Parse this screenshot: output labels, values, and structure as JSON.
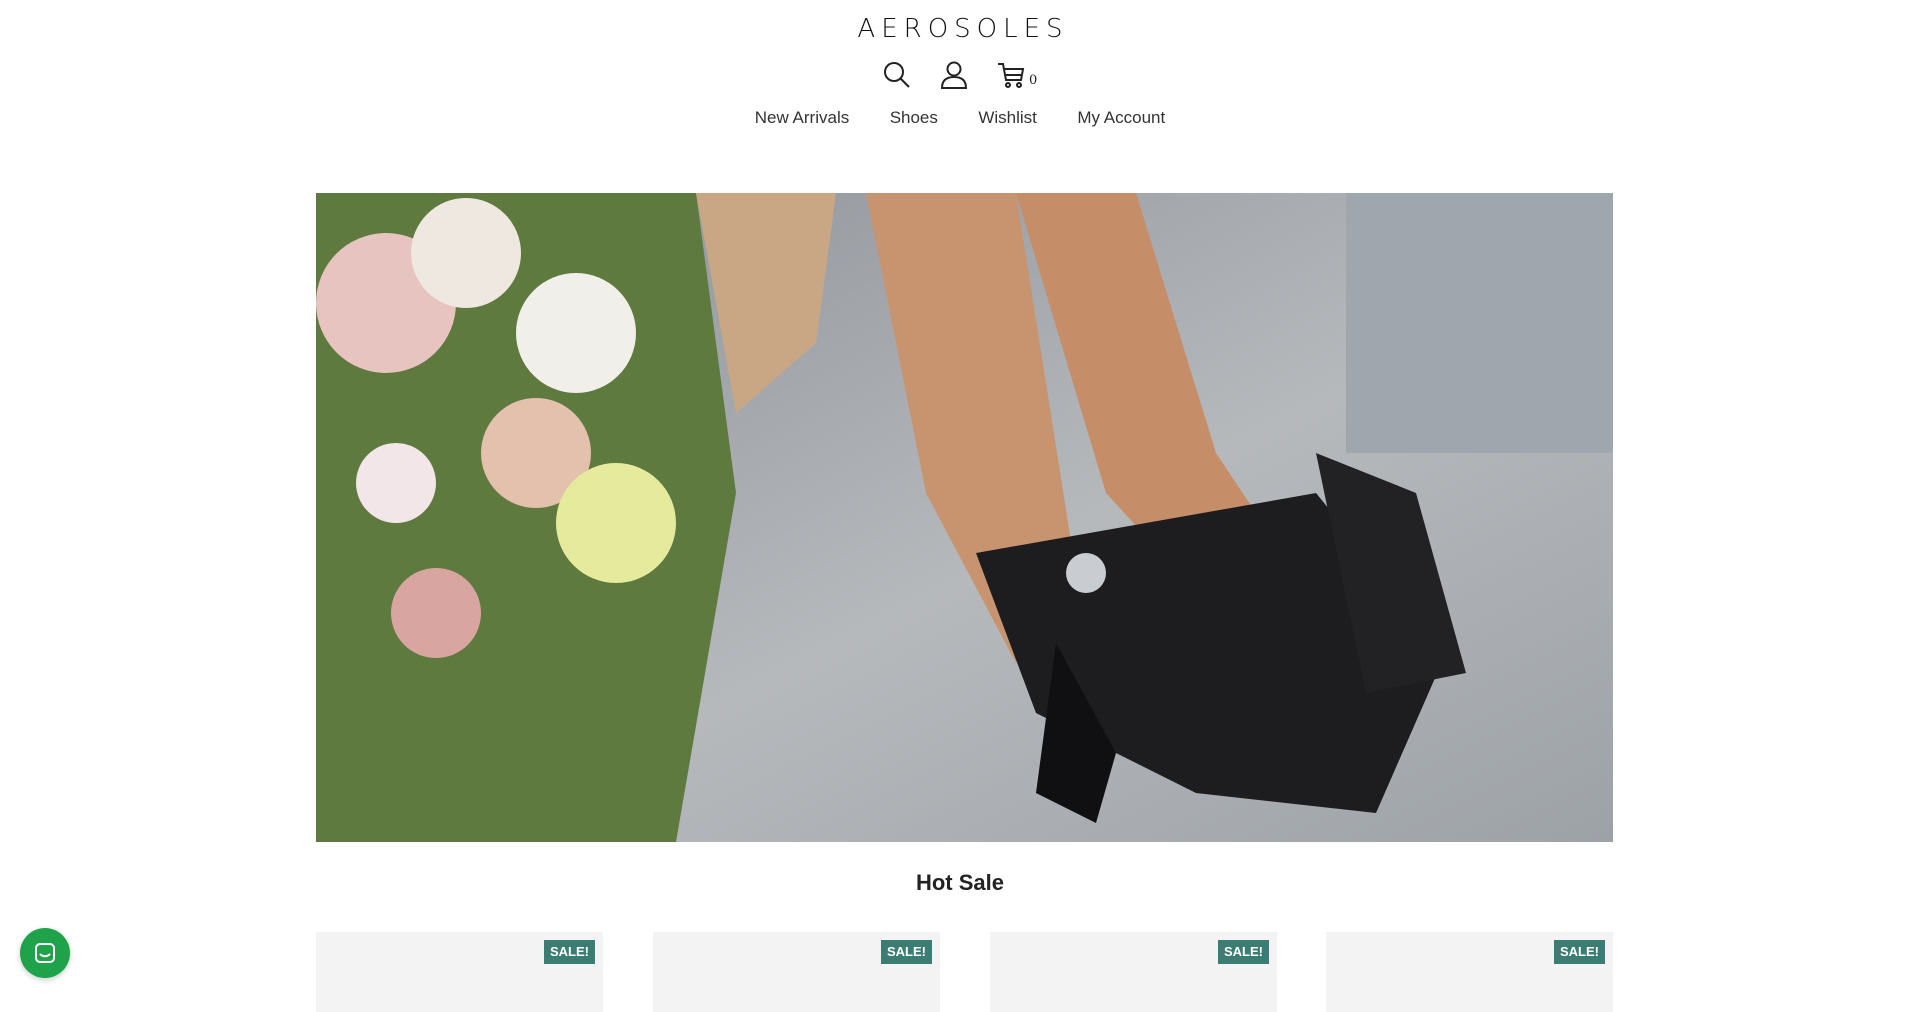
{
  "brand": {
    "logo_text": "AEROSOLES"
  },
  "header_icons": {
    "search": "search-icon",
    "account": "user-icon",
    "cart": "cart-icon",
    "cart_count": "0"
  },
  "nav": {
    "items": [
      {
        "label": "New Arrivals"
      },
      {
        "label": "Shoes"
      },
      {
        "label": "Wishlist"
      },
      {
        "label": "My Account"
      }
    ]
  },
  "hero": {
    "image": "hero-image"
  },
  "hot_sale": {
    "title": "Hot Sale",
    "products": [
      {
        "badge": "SALE!"
      },
      {
        "badge": "SALE!"
      },
      {
        "badge": "SALE!"
      },
      {
        "badge": "SALE!"
      }
    ]
  },
  "chat": {
    "icon": "chat-icon"
  },
  "colors": {
    "badge_bg": "#3b7d72",
    "chat_bg": "#1fa34a",
    "text": "#222222"
  }
}
